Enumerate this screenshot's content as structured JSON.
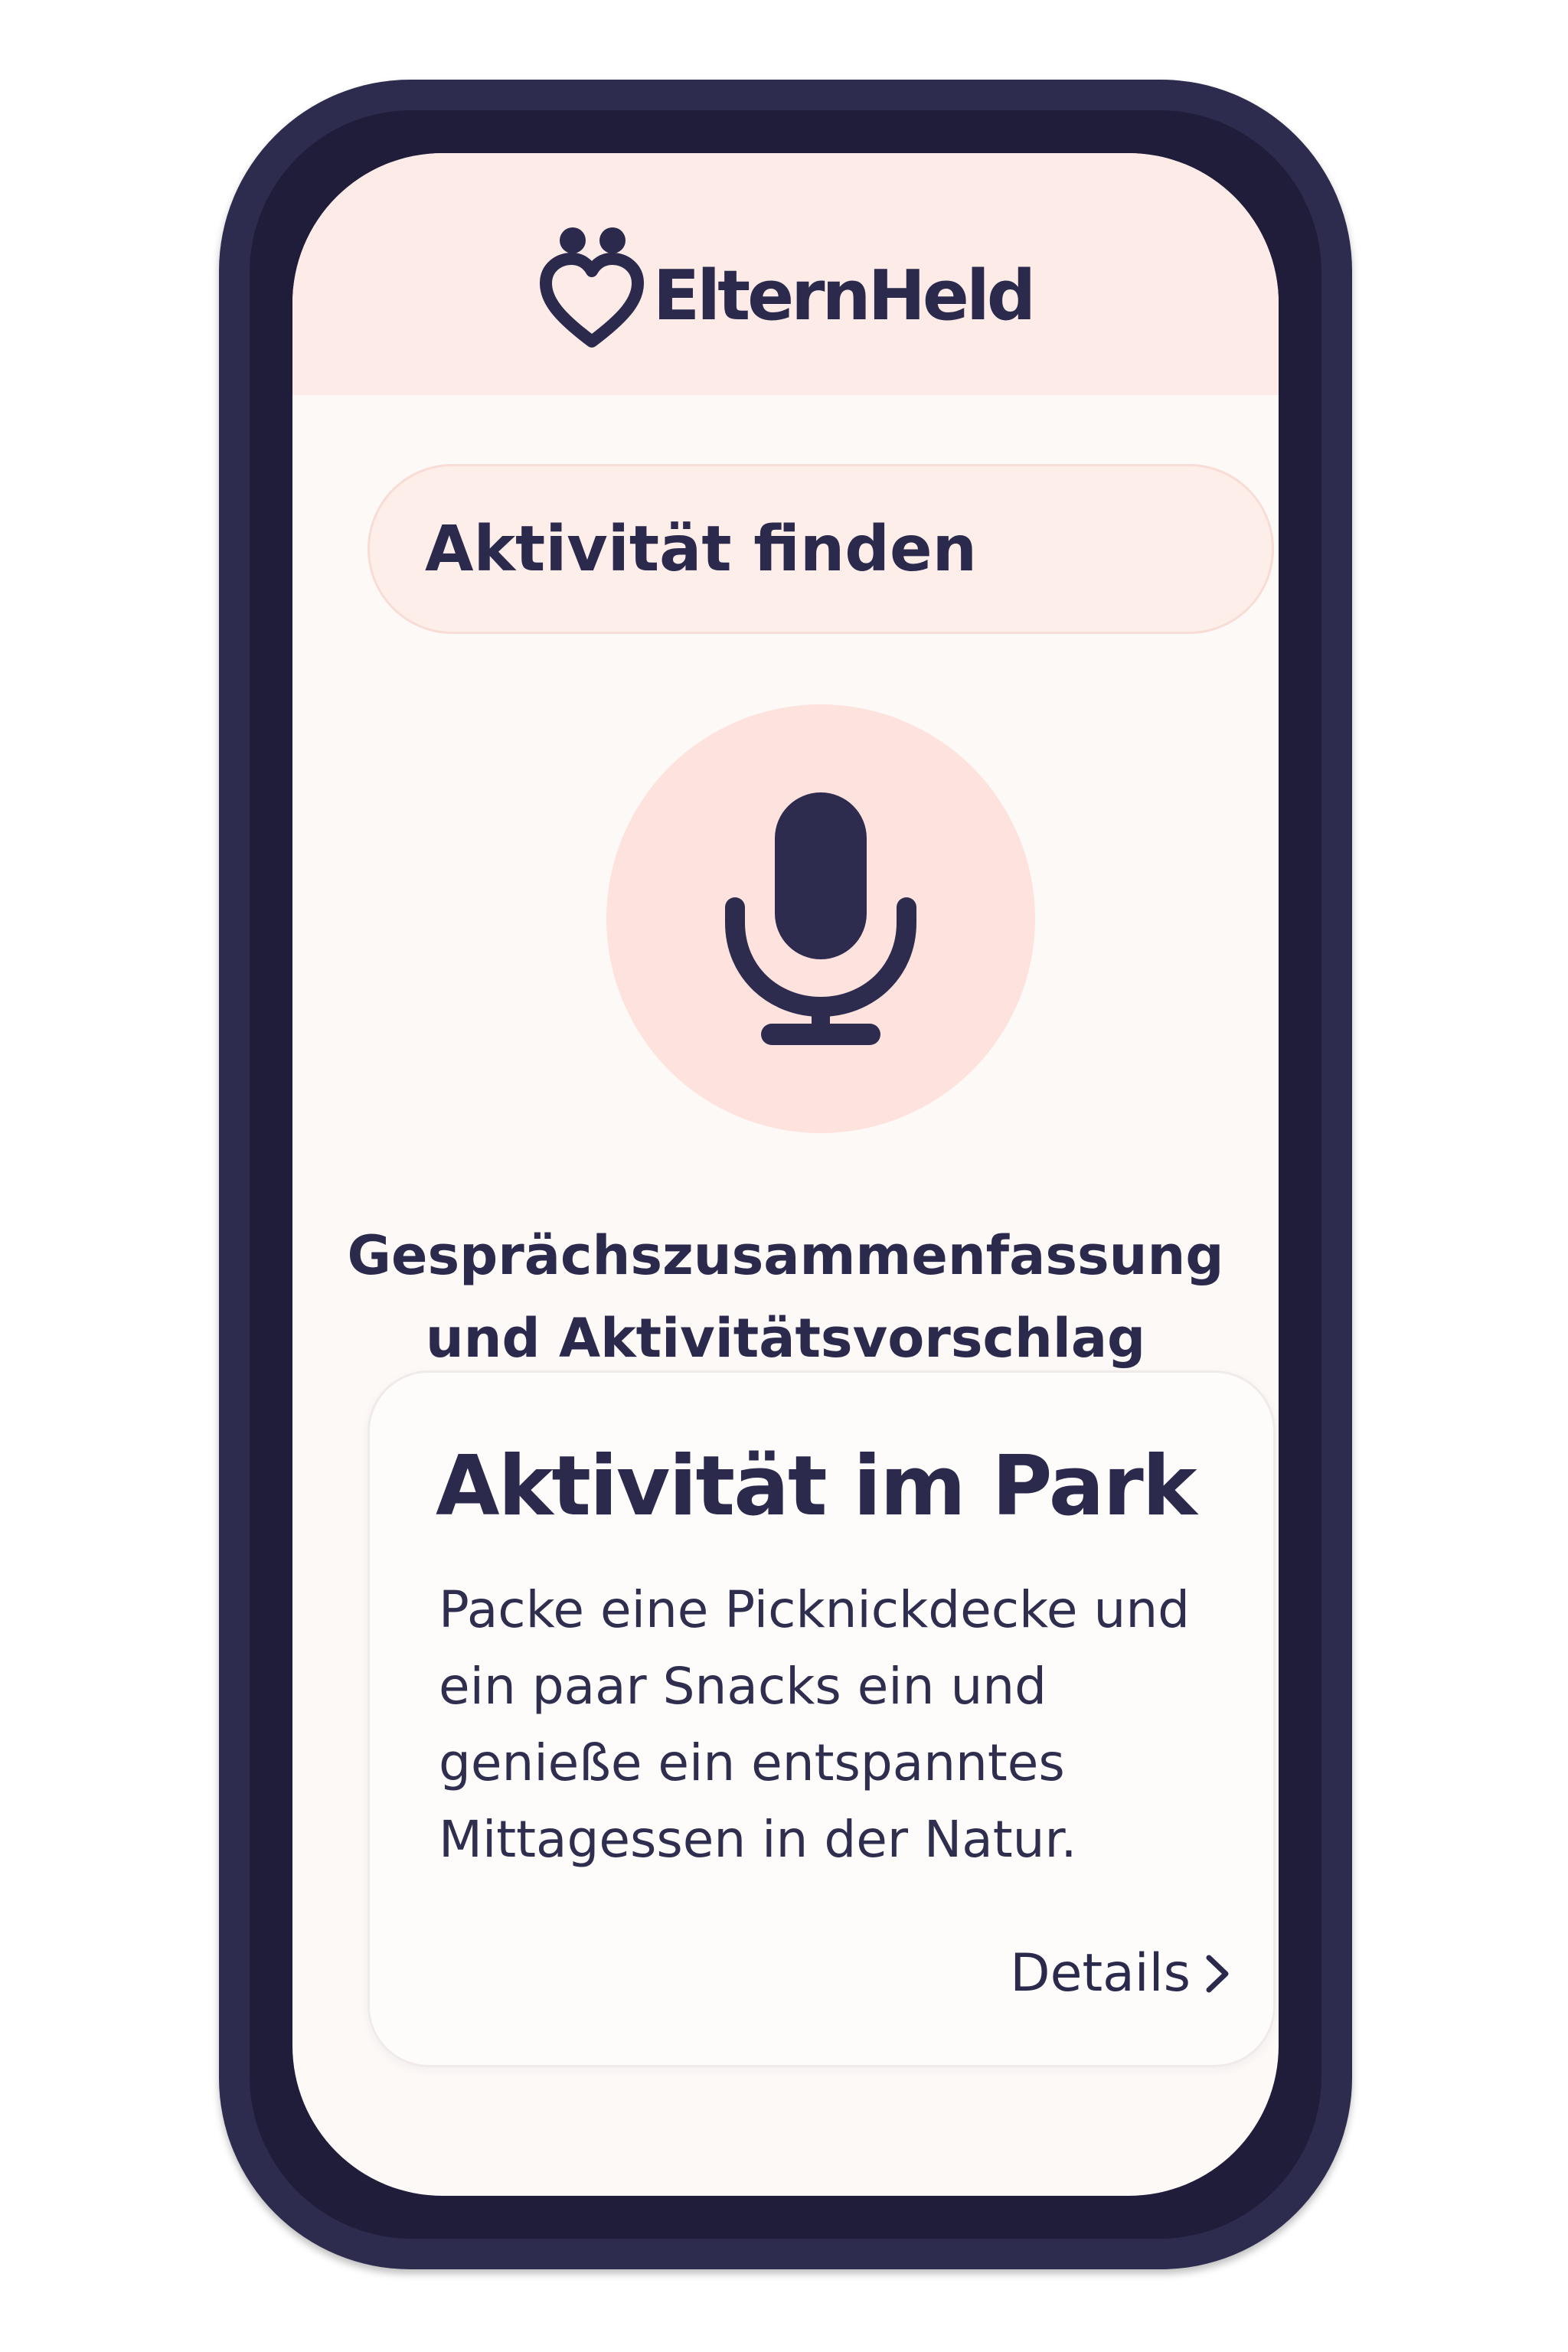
{
  "app": {
    "brand_name": "ElternHeld",
    "logo_icon": "heart-with-two-heads-icon"
  },
  "search": {
    "label": "Aktivität finden"
  },
  "mic": {
    "icon": "microphone-icon"
  },
  "summary": {
    "line1": "Gesprächszusammenfassung",
    "line2": "und Aktivitätsvorschlag"
  },
  "card": {
    "title": "Aktivität im Park",
    "body_lines": [
      "Packe eine Picknickdecke und",
      "ein paar Snacks ein und",
      "genieße ein entspanntes",
      "Mittagessen in der Natur."
    ],
    "details_label": "Details",
    "details_icon": "chevron-right-icon"
  },
  "colors": {
    "primary": "#2d2b4e",
    "header_bg": "#fdebe7",
    "screen_bg": "#fdf9f7",
    "mic_bg": "#fde2dd",
    "pill_bg": "#fdeeea"
  }
}
